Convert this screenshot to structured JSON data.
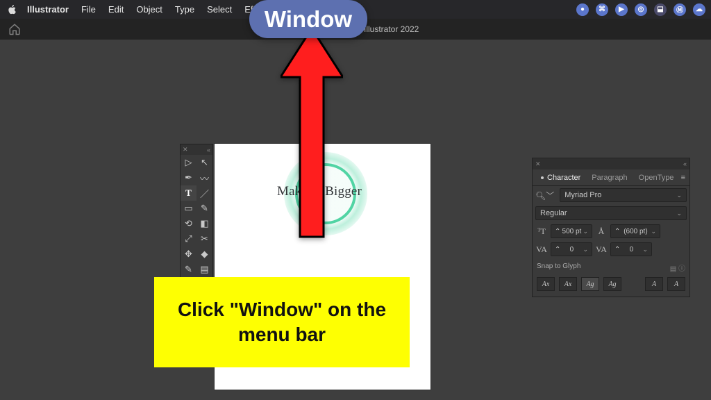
{
  "menubar": {
    "app": "Illustrator",
    "items": [
      "File",
      "Edit",
      "Object",
      "Type",
      "Select",
      "Effect"
    ]
  },
  "titlebar": {
    "doc": "obe Illustrator 2022"
  },
  "artboard": {
    "text": "Mak     ext Bigger"
  },
  "char_panel": {
    "tabs": {
      "t1": "Character",
      "t2": "Paragraph",
      "t3": "OpenType"
    },
    "font": "Myriad Pro",
    "weight": "Regular",
    "size_label": "500 pt",
    "leading_label": "(600 pt)",
    "kerning": "0",
    "tracking": "0",
    "snap_title": "Snap to Glyph",
    "snap_icons": [
      "Ax",
      "Ax",
      "Ag",
      "Ag",
      "A",
      "A"
    ]
  },
  "callouts": {
    "window": "Window",
    "instruction": "Click \"Window\" on the menu bar"
  }
}
